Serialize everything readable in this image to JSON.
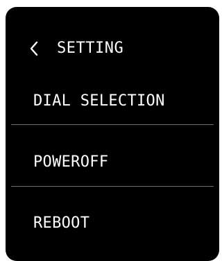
{
  "header": {
    "back_icon": "chevron-left-icon",
    "title": "SETTING"
  },
  "menu": {
    "items": [
      {
        "label": "DIAL SELECTION"
      },
      {
        "label": "POWEROFF"
      },
      {
        "label": "REBOOT"
      }
    ]
  },
  "colors": {
    "background": "#000000",
    "text": "#ffffff",
    "divider": "#6e6e6e"
  }
}
